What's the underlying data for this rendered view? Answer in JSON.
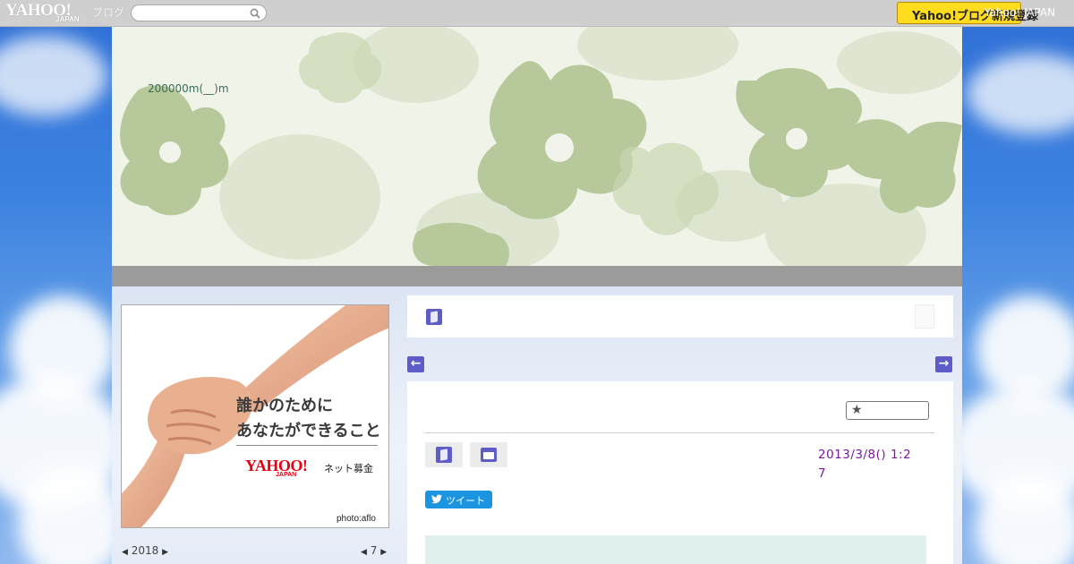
{
  "topbar": {
    "logo_text": "YAHOO!",
    "logo_sub": "JAPAN",
    "blog_label": "ブログ",
    "search_placeholder": "",
    "yj_button_label": "Yahoo!ブログ新規登録",
    "yj_link": "Yahoo! JAPAN"
  },
  "header": {
    "blog_title": "200000m(__)m"
  },
  "ad": {
    "line1": "誰かのために",
    "line2": "あなたができること",
    "brand": "YAHOO!",
    "brand_sub": "JAPAN",
    "service": "ネット募金",
    "credit": "photo:aflo"
  },
  "calendar": {
    "year": "2018",
    "month": "7"
  },
  "article": {
    "date": "2013/3/8()  1:27",
    "tweet_label": "ツイート"
  },
  "colors": {
    "accent": "#5e5cc6",
    "date_text": "#7a1a9a",
    "tweet": "#1b95e0",
    "yj_button": "#ffdc1e"
  }
}
